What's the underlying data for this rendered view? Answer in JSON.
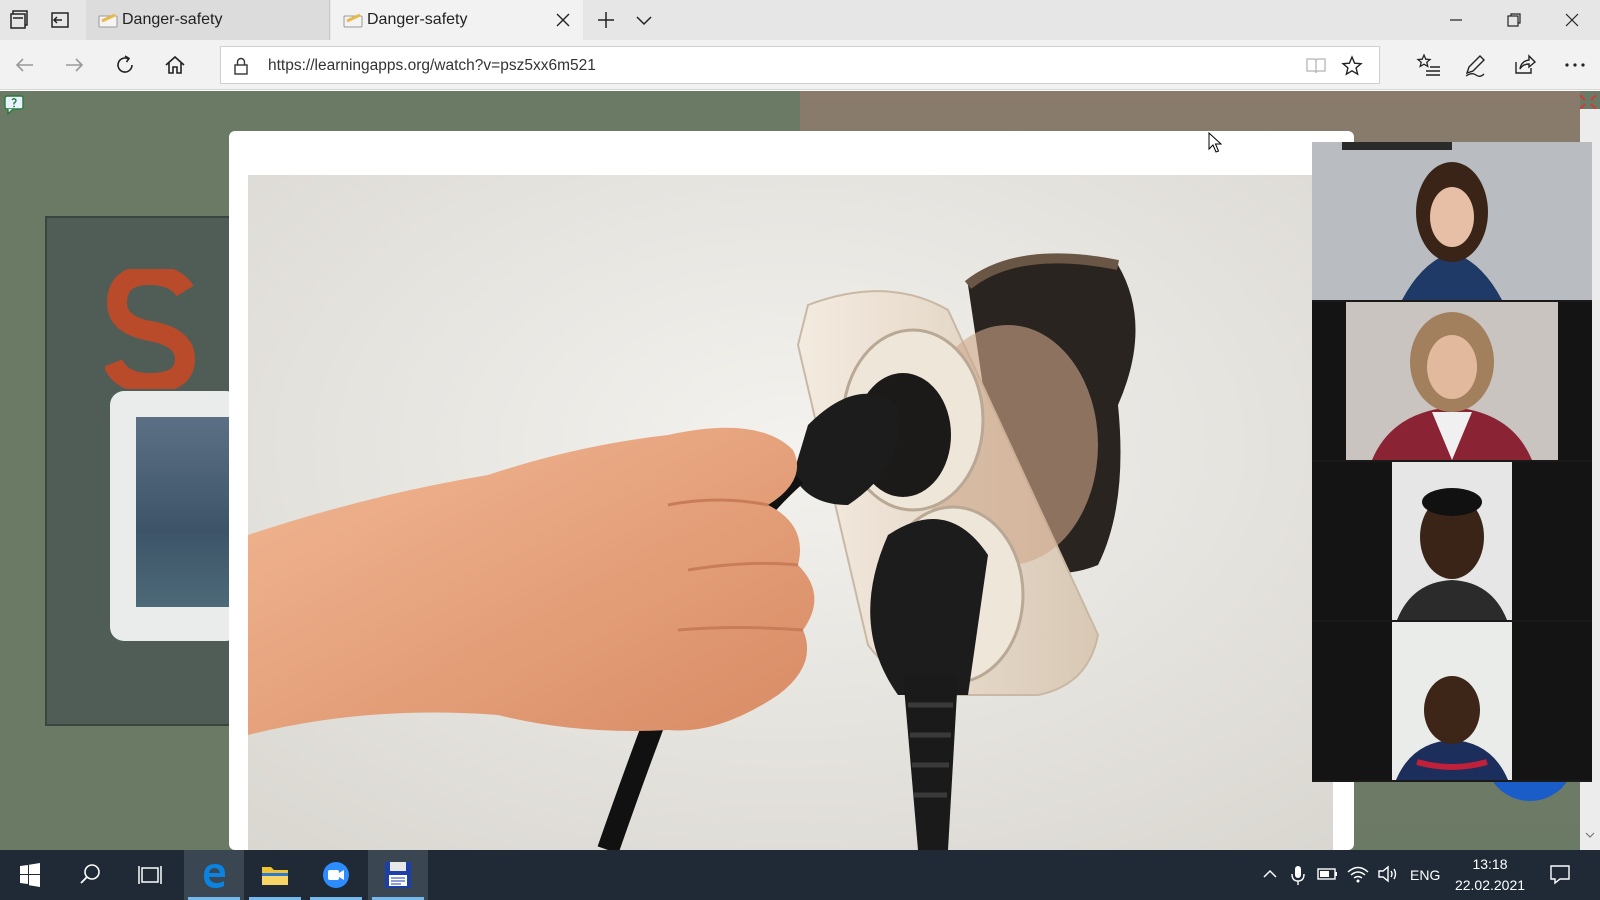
{
  "browser": {
    "tabs": [
      {
        "title": "Danger-safety",
        "active": false
      },
      {
        "title": "Danger-safety",
        "active": true
      }
    ],
    "url": "https://learningapps.org/watch?v=psz5xx6m521"
  },
  "taskbar": {
    "language": "ENG",
    "time": "13:18",
    "date": "22.02.2021",
    "apps": [
      "start",
      "search",
      "task-view",
      "edge",
      "file-explorer",
      "zoom",
      "floppy-app"
    ]
  },
  "content": {
    "image_description_icon": "hand-unplugging-plug-icon",
    "participants": 4
  },
  "colors": {
    "taskbar": "#1f2a36",
    "edge_accent": "#0078d7",
    "fab": "#1a5cc8"
  }
}
